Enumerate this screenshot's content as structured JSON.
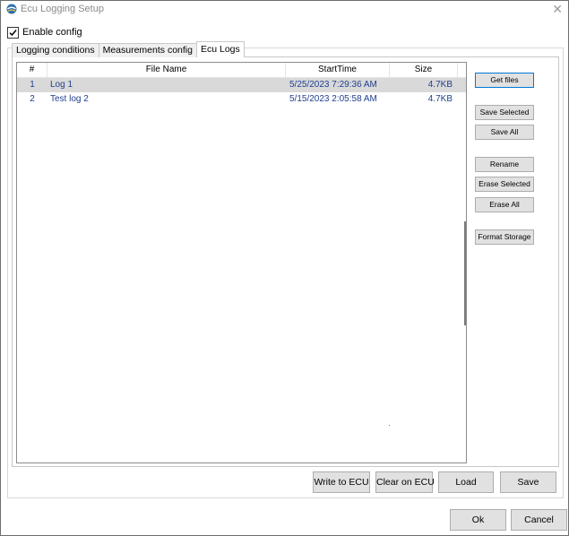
{
  "window": {
    "title": "Ecu Logging Setup",
    "close_glyph": "✕"
  },
  "enable_config": {
    "label": "Enable config",
    "checked": true
  },
  "tabs": [
    {
      "label": "Logging conditions",
      "active": false
    },
    {
      "label": "Measurements config",
      "active": false
    },
    {
      "label": "Ecu Logs",
      "active": true
    }
  ],
  "file_list": {
    "columns": [
      "#",
      "File Name",
      "StartTime",
      "Size"
    ],
    "rows": [
      {
        "num": "1",
        "name": "Log 1",
        "start": "5/25/2023 7:29:36 AM",
        "size": "4.7KB",
        "selected": true
      },
      {
        "num": "2",
        "name": "Test log 2",
        "start": "5/15/2023 2:05:58 AM",
        "size": "4.7KB",
        "selected": false
      }
    ]
  },
  "side_buttons": {
    "get_files": "Get files",
    "save_selected": "Save Selected",
    "save_all": "Save All",
    "rename": "Rename",
    "erase_selected": "Erase Selected",
    "erase_all": "Erase All",
    "format_storage": "Format Storage"
  },
  "bottom_buttons": {
    "write_to_ecu": "Write to ECU",
    "clear_on_ecu": "Clear on ECU",
    "load": "Load",
    "save": "Save"
  },
  "dialog_buttons": {
    "ok": "Ok",
    "cancel": "Cancel"
  },
  "colors": {
    "accent": "#0078d7",
    "row_text": "#1f3f8f",
    "button_face": "#e1e1e1"
  },
  "icons": {
    "app": "app-logo-icon",
    "check": "checkmark-icon",
    "close": "close-icon"
  }
}
